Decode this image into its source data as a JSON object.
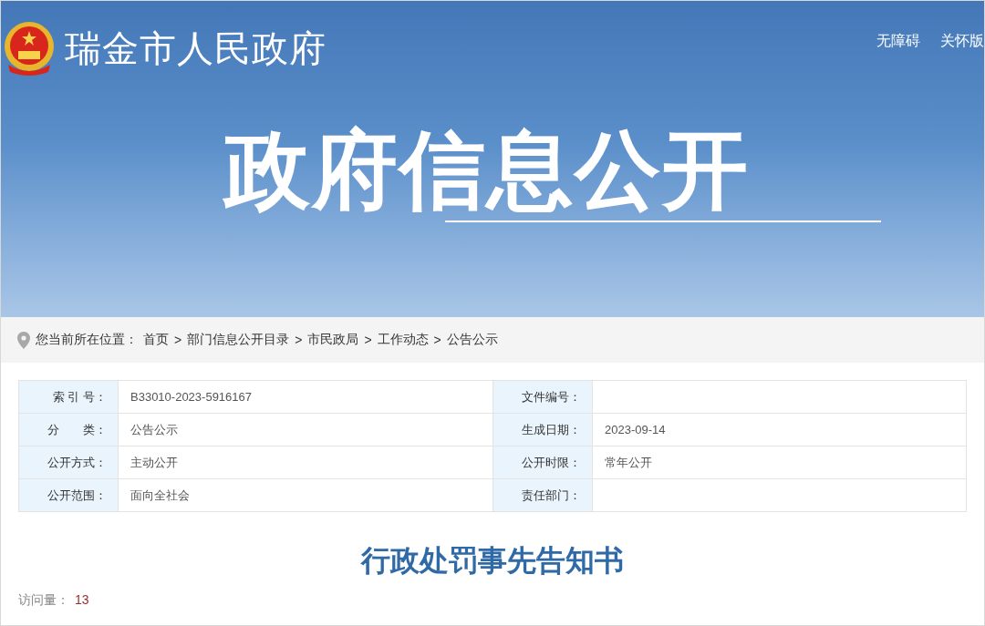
{
  "header": {
    "site_title": "瑞金市人民政府",
    "links": [
      "无障碍",
      "关怀版"
    ],
    "banner_title": "政府信息公开"
  },
  "breadcrumb": {
    "label": "您当前所在位置：",
    "separator": ">",
    "items": [
      "首页",
      "部门信息公开目录",
      "市民政局",
      "工作动态",
      "公告公示"
    ]
  },
  "info_table": {
    "rows": [
      {
        "label_1": "索 引 号：",
        "value_1": "B33010-2023-5916167",
        "label_2": "文件编号：",
        "value_2": ""
      },
      {
        "label_1": "分　　类：",
        "value_1": "公告公示",
        "label_2": "生成日期：",
        "value_2": "2023-09-14"
      },
      {
        "label_1": "公开方式：",
        "value_1": "主动公开",
        "label_2": "公开时限：",
        "value_2": "常年公开"
      },
      {
        "label_1": "公开范围：",
        "value_1": "面向全社会",
        "label_2": "责任部门：",
        "value_2": ""
      }
    ]
  },
  "article": {
    "title": "行政处罚事先告知书",
    "visits_label": "访问量：",
    "visits": "13"
  }
}
